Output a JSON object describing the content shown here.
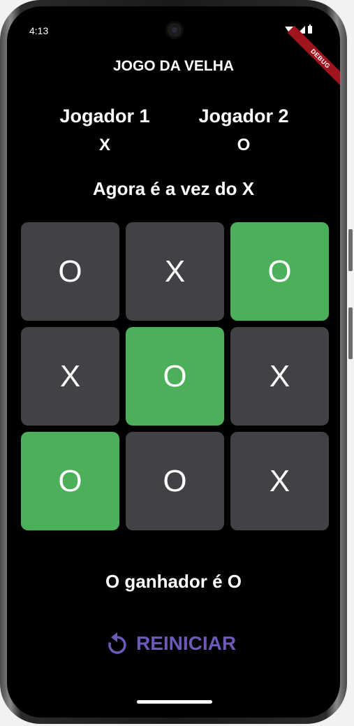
{
  "status_bar": {
    "time": "4:13"
  },
  "debug_banner": "DEBUG",
  "header": {
    "title": "JOGO DA VELHA"
  },
  "players": [
    {
      "name": "Jogador 1",
      "symbol": "X"
    },
    {
      "name": "Jogador 2",
      "symbol": "O"
    }
  ],
  "turn_text": "Agora é a vez do X",
  "board": {
    "cells": [
      {
        "value": "O",
        "winning": false
      },
      {
        "value": "X",
        "winning": false
      },
      {
        "value": "O",
        "winning": true
      },
      {
        "value": "X",
        "winning": false
      },
      {
        "value": "O",
        "winning": true
      },
      {
        "value": "X",
        "winning": false
      },
      {
        "value": "O",
        "winning": true
      },
      {
        "value": "O",
        "winning": false
      },
      {
        "value": "X",
        "winning": false
      }
    ]
  },
  "winner_text": "O ganhador é O",
  "restart": {
    "label": "REINICIAR",
    "icon": "restart-icon"
  },
  "colors": {
    "background": "#000000",
    "cell": "#424146",
    "win_cell": "#4caf59",
    "accent": "#6d5ab8",
    "debug": "#a0141e"
  }
}
